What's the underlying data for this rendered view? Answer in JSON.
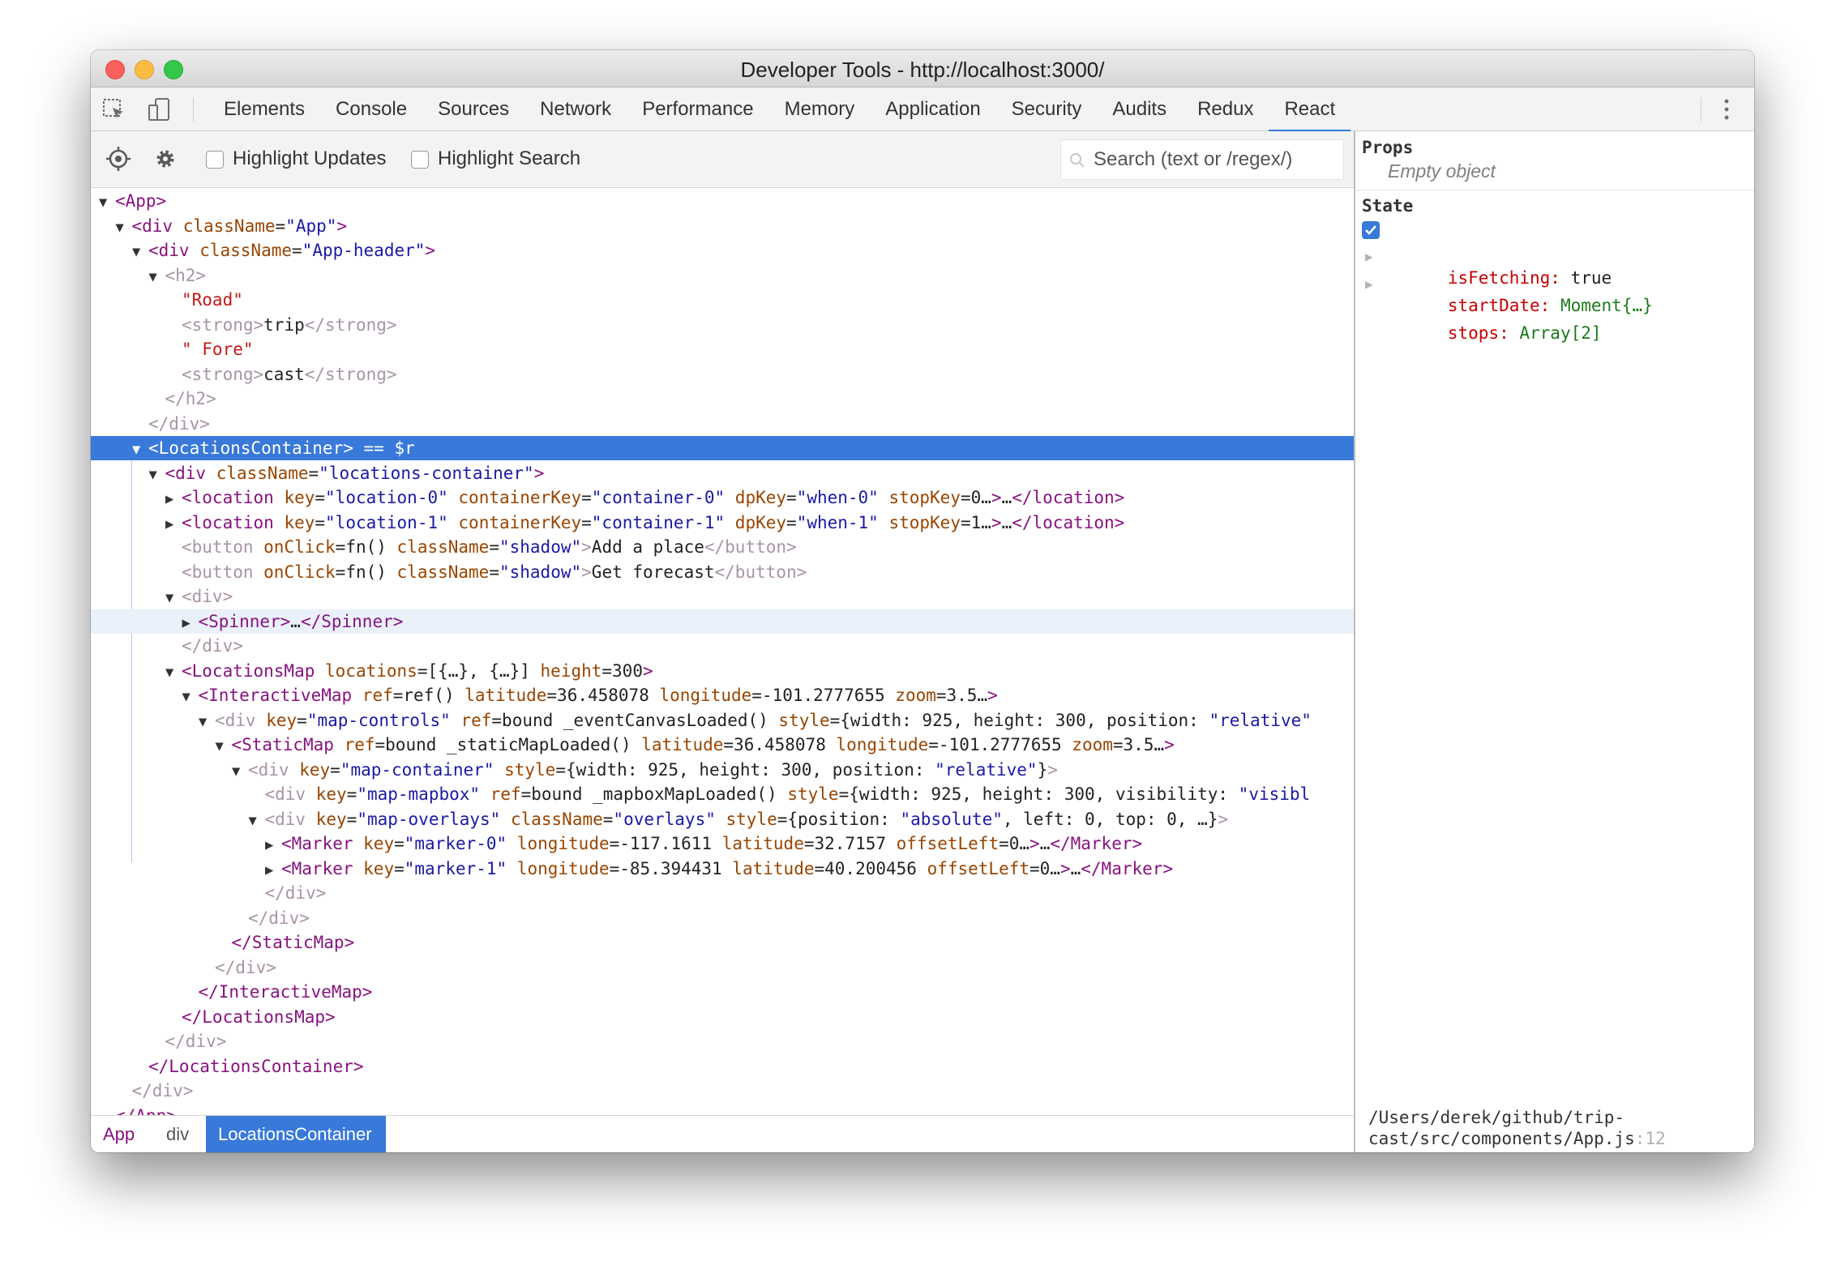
{
  "window": {
    "title": "Developer Tools - http://localhost:3000/"
  },
  "tabs": [
    "Elements",
    "Console",
    "Sources",
    "Network",
    "Performance",
    "Memory",
    "Application",
    "Security",
    "Audits",
    "Redux",
    "React"
  ],
  "active_tab": "React",
  "react_toolbar": {
    "highlight_updates_label": "Highlight Updates",
    "highlight_search_label": "Highlight Search",
    "search_placeholder": "Search (text or /regex/)"
  },
  "tree": [
    {
      "indent": 0,
      "arrow": "▼",
      "parts": [
        [
          "tg",
          "<App>"
        ]
      ]
    },
    {
      "indent": 1,
      "arrow": "▼",
      "parts": [
        [
          "tg",
          "<div "
        ],
        [
          "an",
          "className"
        ],
        [
          "tx",
          "="
        ],
        [
          "av",
          "\"App\""
        ],
        [
          "tg",
          ">"
        ]
      ]
    },
    {
      "indent": 2,
      "arrow": "▼",
      "parts": [
        [
          "tg",
          "<div "
        ],
        [
          "an",
          "className"
        ],
        [
          "tx",
          "="
        ],
        [
          "av",
          "\"App-header\""
        ],
        [
          "tg",
          ">"
        ]
      ]
    },
    {
      "indent": 3,
      "arrow": "▼",
      "parts": [
        [
          "tgp",
          "<h2>"
        ]
      ]
    },
    {
      "indent": 4,
      "arrow": "",
      "parts": [
        [
          "str",
          "\"Road\""
        ]
      ]
    },
    {
      "indent": 4,
      "arrow": "",
      "parts": [
        [
          "tgp",
          "<strong>"
        ],
        [
          "tx",
          "trip"
        ],
        [
          "tgp",
          "</strong>"
        ]
      ]
    },
    {
      "indent": 4,
      "arrow": "",
      "parts": [
        [
          "str",
          "\" Fore\""
        ]
      ]
    },
    {
      "indent": 4,
      "arrow": "",
      "parts": [
        [
          "tgp",
          "<strong>"
        ],
        [
          "tx",
          "cast"
        ],
        [
          "tgp",
          "</strong>"
        ]
      ]
    },
    {
      "indent": 3,
      "arrow": "",
      "parts": [
        [
          "tgp",
          "</h2>"
        ]
      ]
    },
    {
      "indent": 2,
      "arrow": "",
      "parts": [
        [
          "tgp",
          "</div>"
        ]
      ]
    },
    {
      "indent": 2,
      "arrow": "▼",
      "sel": true,
      "parts": [
        [
          "tg",
          "<LocationsContainer>"
        ],
        [
          "tx",
          " == $r"
        ]
      ]
    },
    {
      "indent": 3,
      "arrow": "▼",
      "parts": [
        [
          "tg",
          "<div "
        ],
        [
          "an",
          "className"
        ],
        [
          "tx",
          "="
        ],
        [
          "av",
          "\"locations-container\""
        ],
        [
          "tg",
          ">"
        ]
      ]
    },
    {
      "indent": 4,
      "arrow": "▶",
      "parts": [
        [
          "tg",
          "<location "
        ],
        [
          "an",
          "key"
        ],
        [
          "tx",
          "="
        ],
        [
          "av",
          "\"location-0\" "
        ],
        [
          "an",
          "containerKey"
        ],
        [
          "tx",
          "="
        ],
        [
          "av",
          "\"container-0\" "
        ],
        [
          "an",
          "dpKey"
        ],
        [
          "tx",
          "="
        ],
        [
          "av",
          "\"when-0\" "
        ],
        [
          "an",
          "stopKey"
        ],
        [
          "tx",
          "=0…"
        ],
        [
          "tg",
          ">"
        ],
        [
          "tx",
          "…"
        ],
        [
          "tg",
          "</location>"
        ]
      ]
    },
    {
      "indent": 4,
      "arrow": "▶",
      "parts": [
        [
          "tg",
          "<location "
        ],
        [
          "an",
          "key"
        ],
        [
          "tx",
          "="
        ],
        [
          "av",
          "\"location-1\" "
        ],
        [
          "an",
          "containerKey"
        ],
        [
          "tx",
          "="
        ],
        [
          "av",
          "\"container-1\" "
        ],
        [
          "an",
          "dpKey"
        ],
        [
          "tx",
          "="
        ],
        [
          "av",
          "\"when-1\" "
        ],
        [
          "an",
          "stopKey"
        ],
        [
          "tx",
          "=1…"
        ],
        [
          "tg",
          ">"
        ],
        [
          "tx",
          "…"
        ],
        [
          "tg",
          "</location>"
        ]
      ]
    },
    {
      "indent": 4,
      "arrow": "",
      "parts": [
        [
          "tgp",
          "<button "
        ],
        [
          "an",
          "onClick"
        ],
        [
          "tx",
          "=fn() "
        ],
        [
          "an",
          "className"
        ],
        [
          "tx",
          "="
        ],
        [
          "av",
          "\"shadow\""
        ],
        [
          "tgp",
          ">"
        ],
        [
          "tx",
          "Add a place"
        ],
        [
          "tgp",
          "</button>"
        ]
      ]
    },
    {
      "indent": 4,
      "arrow": "",
      "parts": [
        [
          "tgp",
          "<button "
        ],
        [
          "an",
          "onClick"
        ],
        [
          "tx",
          "=fn() "
        ],
        [
          "an",
          "className"
        ],
        [
          "tx",
          "="
        ],
        [
          "av",
          "\"shadow\""
        ],
        [
          "tgp",
          ">"
        ],
        [
          "tx",
          "Get forecast"
        ],
        [
          "tgp",
          "</button>"
        ]
      ]
    },
    {
      "indent": 4,
      "arrow": "▼",
      "parts": [
        [
          "tgp",
          "<div>"
        ]
      ]
    },
    {
      "indent": 5,
      "arrow": "▶",
      "hover": true,
      "parts": [
        [
          "tg",
          "<Spinner>"
        ],
        [
          "tx",
          "…"
        ],
        [
          "tg",
          "</Spinner>"
        ]
      ]
    },
    {
      "indent": 4,
      "arrow": "",
      "parts": [
        [
          "tgp",
          "</div>"
        ]
      ]
    },
    {
      "indent": 4,
      "arrow": "▼",
      "parts": [
        [
          "tg",
          "<LocationsMap "
        ],
        [
          "an",
          "locations"
        ],
        [
          "tx",
          "=[{…}, {…}] "
        ],
        [
          "an",
          "height"
        ],
        [
          "tx",
          "=300"
        ],
        [
          "tg",
          ">"
        ]
      ]
    },
    {
      "indent": 5,
      "arrow": "▼",
      "parts": [
        [
          "tg",
          "<InteractiveMap "
        ],
        [
          "an",
          "ref"
        ],
        [
          "tx",
          "=ref() "
        ],
        [
          "an",
          "latitude"
        ],
        [
          "tx",
          "=36.458078 "
        ],
        [
          "an",
          "longitude"
        ],
        [
          "tx",
          "=-101.2777655 "
        ],
        [
          "an",
          "zoom"
        ],
        [
          "tx",
          "=3.5…"
        ],
        [
          "tg",
          ">"
        ]
      ]
    },
    {
      "indent": 6,
      "arrow": "▼",
      "parts": [
        [
          "tgp",
          "<div "
        ],
        [
          "an",
          "key"
        ],
        [
          "tx",
          "="
        ],
        [
          "av",
          "\"map-controls\" "
        ],
        [
          "an",
          "ref"
        ],
        [
          "tx",
          "=bound _eventCanvasLoaded() "
        ],
        [
          "an",
          "style"
        ],
        [
          "tx",
          "={width: 925, height: 300, position: "
        ],
        [
          "av",
          "\"relative\""
        ]
      ]
    },
    {
      "indent": 7,
      "arrow": "▼",
      "parts": [
        [
          "tg",
          "<StaticMap "
        ],
        [
          "an",
          "ref"
        ],
        [
          "tx",
          "=bound _staticMapLoaded() "
        ],
        [
          "an",
          "latitude"
        ],
        [
          "tx",
          "=36.458078 "
        ],
        [
          "an",
          "longitude"
        ],
        [
          "tx",
          "=-101.2777655 "
        ],
        [
          "an",
          "zoom"
        ],
        [
          "tx",
          "=3.5…"
        ],
        [
          "tg",
          ">"
        ]
      ]
    },
    {
      "indent": 8,
      "arrow": "▼",
      "parts": [
        [
          "tgp",
          "<div "
        ],
        [
          "an",
          "key"
        ],
        [
          "tx",
          "="
        ],
        [
          "av",
          "\"map-container\" "
        ],
        [
          "an",
          "style"
        ],
        [
          "tx",
          "={width: 925, height: 300, position: "
        ],
        [
          "av",
          "\"relative\""
        ],
        [
          "tx",
          "}"
        ],
        [
          "tgp",
          ">"
        ]
      ]
    },
    {
      "indent": 9,
      "arrow": "",
      "parts": [
        [
          "tgp",
          "<div "
        ],
        [
          "an",
          "key"
        ],
        [
          "tx",
          "="
        ],
        [
          "av",
          "\"map-mapbox\" "
        ],
        [
          "an",
          "ref"
        ],
        [
          "tx",
          "=bound _mapboxMapLoaded() "
        ],
        [
          "an",
          "style"
        ],
        [
          "tx",
          "={width: 925, height: 300, visibility: "
        ],
        [
          "av",
          "\"visibl"
        ]
      ]
    },
    {
      "indent": 9,
      "arrow": "▼",
      "parts": [
        [
          "tgp",
          "<div "
        ],
        [
          "an",
          "key"
        ],
        [
          "tx",
          "="
        ],
        [
          "av",
          "\"map-overlays\" "
        ],
        [
          "an",
          "className"
        ],
        [
          "tx",
          "="
        ],
        [
          "av",
          "\"overlays\" "
        ],
        [
          "an",
          "style"
        ],
        [
          "tx",
          "={position: "
        ],
        [
          "av",
          "\"absolute\""
        ],
        [
          "tx",
          ", left: 0, top: 0, …}"
        ],
        [
          "tgp",
          ">"
        ]
      ]
    },
    {
      "indent": 10,
      "arrow": "▶",
      "parts": [
        [
          "tg",
          "<Marker "
        ],
        [
          "an",
          "key"
        ],
        [
          "tx",
          "="
        ],
        [
          "av",
          "\"marker-0\" "
        ],
        [
          "an",
          "longitude"
        ],
        [
          "tx",
          "=-117.1611 "
        ],
        [
          "an",
          "latitude"
        ],
        [
          "tx",
          "=32.7157 "
        ],
        [
          "an",
          "offsetLeft"
        ],
        [
          "tx",
          "=0…"
        ],
        [
          "tg",
          ">"
        ],
        [
          "tx",
          "…"
        ],
        [
          "tg",
          "</Marker>"
        ]
      ]
    },
    {
      "indent": 10,
      "arrow": "▶",
      "parts": [
        [
          "tg",
          "<Marker "
        ],
        [
          "an",
          "key"
        ],
        [
          "tx",
          "="
        ],
        [
          "av",
          "\"marker-1\" "
        ],
        [
          "an",
          "longitude"
        ],
        [
          "tx",
          "=-85.394431 "
        ],
        [
          "an",
          "latitude"
        ],
        [
          "tx",
          "=40.200456 "
        ],
        [
          "an",
          "offsetLeft"
        ],
        [
          "tx",
          "=0…"
        ],
        [
          "tg",
          ">"
        ],
        [
          "tx",
          "…"
        ],
        [
          "tg",
          "</Marker>"
        ]
      ]
    },
    {
      "indent": 9,
      "arrow": "",
      "parts": [
        [
          "tgp",
          "</div>"
        ]
      ]
    },
    {
      "indent": 8,
      "arrow": "",
      "parts": [
        [
          "tgp",
          "</div>"
        ]
      ]
    },
    {
      "indent": 7,
      "arrow": "",
      "parts": [
        [
          "tg",
          "</StaticMap>"
        ]
      ]
    },
    {
      "indent": 6,
      "arrow": "",
      "parts": [
        [
          "tgp",
          "</div>"
        ]
      ]
    },
    {
      "indent": 5,
      "arrow": "",
      "parts": [
        [
          "tg",
          "</InteractiveMap>"
        ]
      ]
    },
    {
      "indent": 4,
      "arrow": "",
      "parts": [
        [
          "tg",
          "</LocationsMap>"
        ]
      ]
    },
    {
      "indent": 3,
      "arrow": "",
      "parts": [
        [
          "tgp",
          "</div>"
        ]
      ]
    },
    {
      "indent": 2,
      "arrow": "",
      "parts": [
        [
          "tg",
          "</LocationsContainer>"
        ]
      ]
    },
    {
      "indent": 1,
      "arrow": "",
      "parts": [
        [
          "tgp",
          "</div>"
        ]
      ]
    },
    {
      "indent": 0,
      "arrow": "",
      "parts": [
        [
          "tg",
          "</App>"
        ]
      ]
    }
  ],
  "breadcrumbs": {
    "app": "App",
    "div": "div",
    "active": "LocationsContainer"
  },
  "side": {
    "props_heading": "Props",
    "props_empty": "Empty object",
    "state_heading": "State",
    "state": [
      {
        "key": "isFetching:",
        "value": "true",
        "checkbox": true
      },
      {
        "key": "startDate:",
        "value": "Moment{…}",
        "expander": true
      },
      {
        "key": "stops:",
        "value": "Array[2]",
        "expander": true
      }
    ],
    "path_line1": "/Users/derek/github/trip-",
    "path_line2": "cast/src/components/App.js",
    "path_linenum": ":12"
  },
  "colors": {
    "accent": "#3879d9",
    "tag": "#881280",
    "attr_name": "#994500",
    "attr_value": "#1a1aa6"
  }
}
